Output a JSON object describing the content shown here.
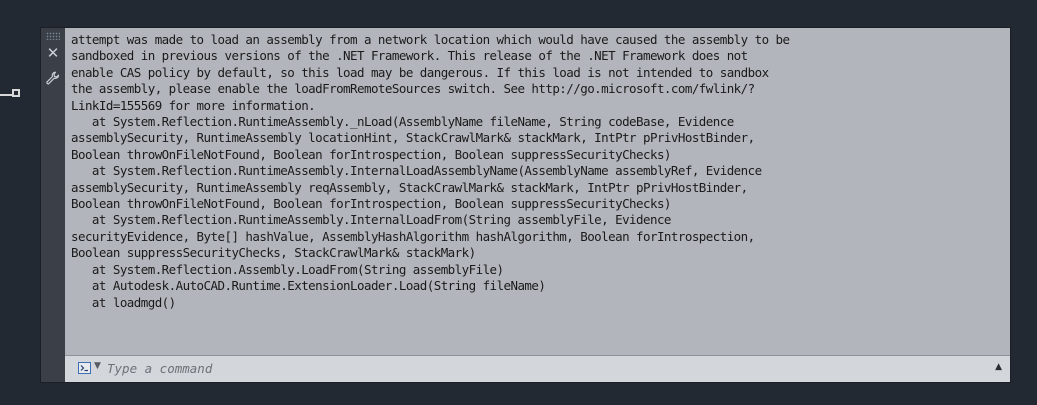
{
  "command_window": {
    "history_lines": [
      "attempt was made to load an assembly from a network location which would have caused the assembly to be",
      "sandboxed in previous versions of the .NET Framework. This release of the .NET Framework does not",
      "enable CAS policy by default, so this load may be dangerous. If this load is not intended to sandbox",
      "the assembly, please enable the loadFromRemoteSources switch. See http://go.microsoft.com/fwlink/?",
      "LinkId=155569 for more information.",
      "   at System.Reflection.RuntimeAssembly._nLoad(AssemblyName fileName, String codeBase, Evidence",
      "assemblySecurity, RuntimeAssembly locationHint, StackCrawlMark& stackMark, IntPtr pPrivHostBinder,",
      "Boolean throwOnFileNotFound, Boolean forIntrospection, Boolean suppressSecurityChecks)",
      "   at System.Reflection.RuntimeAssembly.InternalLoadAssemblyName(AssemblyName assemblyRef, Evidence",
      "assemblySecurity, RuntimeAssembly reqAssembly, StackCrawlMark& stackMark, IntPtr pPrivHostBinder,",
      "Boolean throwOnFileNotFound, Boolean forIntrospection, Boolean suppressSecurityChecks)",
      "   at System.Reflection.RuntimeAssembly.InternalLoadFrom(String assemblyFile, Evidence",
      "securityEvidence, Byte[] hashValue, AssemblyHashAlgorithm hashAlgorithm, Boolean forIntrospection,",
      "Boolean suppressSecurityChecks, StackCrawlMark& stackMark)",
      "   at System.Reflection.Assembly.LoadFrom(String assemblyFile)",
      "   at Autodesk.AutoCAD.Runtime.ExtensionLoader.Load(String fileName)",
      "   at loadmgd()"
    ],
    "input": {
      "value": "",
      "placeholder": "Type a command"
    },
    "icons": {
      "close": "close-icon",
      "settings": "wrench-icon",
      "prompt": "command-prompt-icon",
      "prompt_dropdown": "caret-down-icon",
      "recent_commands": "caret-up-icon"
    }
  },
  "colors": {
    "canvas_background": "#222933",
    "history_background": "#b2b6bc",
    "command_line_background": "#d3d6da",
    "frame": "#3b4048"
  }
}
